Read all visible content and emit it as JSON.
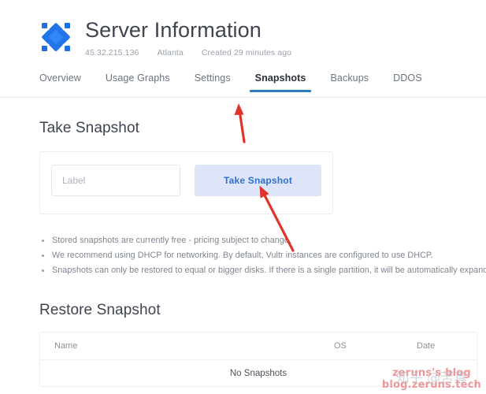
{
  "header": {
    "logo_icon": "vultr-diamond-logo",
    "title": "Server Information",
    "meta": [
      {
        "name": "ip-address",
        "value": "45.32.215.136"
      },
      {
        "name": "region",
        "value": "Atlanta"
      },
      {
        "name": "created",
        "value": "Created 29 minutes ago"
      }
    ]
  },
  "tabs": {
    "active_index": 3,
    "items": [
      {
        "label": "Overview"
      },
      {
        "label": "Usage Graphs"
      },
      {
        "label": "Settings"
      },
      {
        "label": "Snapshots"
      },
      {
        "label": "Backups"
      },
      {
        "label": "DDOS"
      }
    ]
  },
  "take_snapshot": {
    "heading": "Take Snapshot",
    "label_placeholder": "Label",
    "label_value": "",
    "button_label": "Take Snapshot"
  },
  "notes": [
    "Stored snapshots are currently free - pricing subject to change.",
    "We recommend using DHCP for networking. By default, Vultr instances are configured to use DHCP.",
    "Snapshots can only be restored to equal or bigger disks. If there is a single partition, it will be automatically expanded."
  ],
  "restore_snapshot": {
    "heading": "Restore Snapshot",
    "columns": [
      "Name",
      "OS",
      "Date"
    ],
    "rows": [],
    "empty_message": "No Snapshots"
  },
  "annotations": [
    {
      "name": "arrow-to-snapshots-tab",
      "color": "#e0342b",
      "points_at": "Snapshots tab"
    },
    {
      "name": "arrow-to-take-snapshot-button",
      "color": "#e0342b",
      "points_at": "Take Snapshot button"
    }
  ],
  "watermark": {
    "line1": "zeruns's blog",
    "line2": "blog.zeruns.tech",
    "overlay": "知乎 @苦真",
    "color": "#f08e8e"
  },
  "colors": {
    "accent_blue": "#2d7fc1",
    "button_bg": "#dfe5f8",
    "button_text": "#2f6fd0",
    "logo_blue": "#1f6fe0",
    "annotation_red": "#e0342b"
  }
}
